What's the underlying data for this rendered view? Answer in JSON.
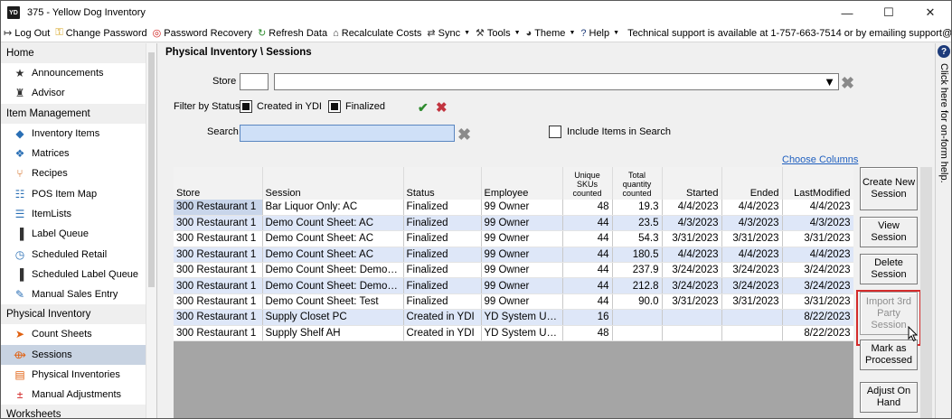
{
  "window": {
    "app_badge": "YD",
    "title": "375 - Yellow Dog Inventory",
    "controls": {
      "minimize": "—",
      "maximize": "☐",
      "close": "✕"
    }
  },
  "menubar": {
    "items": [
      {
        "label": "Log Out",
        "icon": "logout-icon",
        "glyph": "↦",
        "color": "#333333"
      },
      {
        "label": "Change Password",
        "icon": "key-icon",
        "glyph": "⚿",
        "color": "#d4a017"
      },
      {
        "label": "Password Recovery",
        "icon": "lifebuoy-icon",
        "glyph": "◎",
        "color": "#d0201e"
      },
      {
        "label": "Refresh Data",
        "icon": "refresh-icon",
        "glyph": "↻",
        "color": "#2e8b2e"
      },
      {
        "label": "Recalculate Costs",
        "icon": "bank-icon",
        "glyph": "⌂",
        "color": "#333333"
      },
      {
        "label": "Sync",
        "icon": "sync-icon",
        "glyph": "⇄",
        "color": "#333333",
        "dropdown": true
      },
      {
        "label": "Tools",
        "icon": "wrench-icon",
        "glyph": "⚒",
        "color": "#333333",
        "dropdown": true
      },
      {
        "label": "Theme",
        "icon": "palette-icon",
        "glyph": "◕",
        "color": "#333333",
        "dropdown": true
      },
      {
        "label": "Help",
        "icon": "help-icon",
        "glyph": "?",
        "color": "#1d3b7a",
        "dropdown": true
      }
    ],
    "support_text": "Technical support is available at 1-757-663-7514 or by emailing support@yellowdogsoftware.com."
  },
  "sidebar": {
    "sections": [
      {
        "header": "Home",
        "items": [
          {
            "label": "Announcements",
            "icon": "star-icon",
            "glyph": "★",
            "color": "#333333"
          },
          {
            "label": "Advisor",
            "icon": "advisor-icon",
            "glyph": "♜",
            "color": "#333333"
          }
        ]
      },
      {
        "header": "Item Management",
        "items": [
          {
            "label": "Inventory Items",
            "icon": "tag-icon",
            "glyph": "◆",
            "color": "#2a6fb5"
          },
          {
            "label": "Matrices",
            "icon": "cubes-icon",
            "glyph": "❖",
            "color": "#2a6fb5"
          },
          {
            "label": "Recipes",
            "icon": "utensils-icon",
            "glyph": "⑂",
            "color": "#d06010"
          },
          {
            "label": "POS Item Map",
            "icon": "sitemap-icon",
            "glyph": "☷",
            "color": "#2a6fb5"
          },
          {
            "label": "ItemLists",
            "icon": "list-icon",
            "glyph": "☰",
            "color": "#2a6fb5"
          },
          {
            "label": "Label Queue",
            "icon": "barcode-icon",
            "glyph": "▐",
            "color": "#333333"
          },
          {
            "label": "Scheduled Retail",
            "icon": "clock-icon",
            "glyph": "◷",
            "color": "#2a6fb5"
          },
          {
            "label": "Scheduled Label Queue",
            "icon": "barcode-icon",
            "glyph": "▐",
            "color": "#333333"
          },
          {
            "label": "Manual Sales Entry",
            "icon": "edit-icon",
            "glyph": "✎",
            "color": "#2a6fb5"
          }
        ]
      },
      {
        "header": "Physical Inventory",
        "items": [
          {
            "label": "Count Sheets",
            "icon": "send-icon",
            "glyph": "➤",
            "color": "#e06010"
          },
          {
            "label": "Sessions",
            "icon": "sessions-icon",
            "glyph": "⟴",
            "color": "#e06010",
            "selected": true
          },
          {
            "label": "Physical Inventories",
            "icon": "document-icon",
            "glyph": "▤",
            "color": "#e06010"
          },
          {
            "label": "Manual Adjustments",
            "icon": "plusminus-icon",
            "glyph": "±",
            "color": "#d02020"
          }
        ]
      },
      {
        "header": "Worksheets",
        "items": []
      }
    ]
  },
  "main": {
    "breadcrumb": "Physical Inventory \\ Sessions",
    "store_label": "Store",
    "store_code_value": "",
    "store_select_value": "",
    "filter_label": "Filter by Status",
    "filter_options": [
      {
        "label": "Created in YDI",
        "checked": true
      },
      {
        "label": "Finalized",
        "checked": true
      }
    ],
    "search_label": "Search",
    "search_value": "",
    "include_items_label": "Include Items in Search",
    "choose_columns": "Choose Columns"
  },
  "table": {
    "columns": [
      {
        "label": "Store",
        "align": "left"
      },
      {
        "label": "Session",
        "align": "left"
      },
      {
        "label": "Status",
        "align": "left"
      },
      {
        "label": "Employee",
        "align": "left"
      },
      {
        "label": "Unique SKUs counted",
        "align": "center"
      },
      {
        "label": "Total quantity counted",
        "align": "center"
      },
      {
        "label": "Started",
        "align": "right"
      },
      {
        "label": "Ended",
        "align": "right"
      },
      {
        "label": "LastModified",
        "align": "right"
      }
    ],
    "rows": [
      [
        "300 Restaurant 1",
        "Bar Liquor Only: AC",
        "Finalized",
        "99 Owner",
        "48",
        "19.3",
        "4/4/2023",
        "4/4/2023",
        "4/4/2023"
      ],
      [
        "300 Restaurant 1",
        "Demo Count Sheet: AC",
        "Finalized",
        "99 Owner",
        "44",
        "23.5",
        "4/3/2023",
        "4/3/2023",
        "4/3/2023"
      ],
      [
        "300 Restaurant 1",
        "Demo Count Sheet: AC",
        "Finalized",
        "99 Owner",
        "44",
        "54.3",
        "3/31/2023",
        "3/31/2023",
        "3/31/2023"
      ],
      [
        "300 Restaurant 1",
        "Demo Count Sheet: AC",
        "Finalized",
        "99 Owner",
        "44",
        "180.5",
        "4/4/2023",
        "4/4/2023",
        "4/4/2023"
      ],
      [
        "300 Restaurant 1",
        "Demo Count Sheet: Demo S...",
        "Finalized",
        "99 Owner",
        "44",
        "237.9",
        "3/24/2023",
        "3/24/2023",
        "3/24/2023"
      ],
      [
        "300 Restaurant 1",
        "Demo Count Sheet: Demo S...",
        "Finalized",
        "99 Owner",
        "44",
        "212.8",
        "3/24/2023",
        "3/24/2023",
        "3/24/2023"
      ],
      [
        "300 Restaurant 1",
        "Demo Count Sheet: Test",
        "Finalized",
        "99 Owner",
        "44",
        "90.0",
        "3/31/2023",
        "3/31/2023",
        "3/31/2023"
      ],
      [
        "300 Restaurant 1",
        "Supply Closet PC",
        "Created in YDI",
        "YD System User",
        "16",
        "",
        "",
        "",
        "8/22/2023"
      ],
      [
        "300 Restaurant 1",
        "Supply Shelf AH",
        "Created in YDI",
        "YD System User",
        "48",
        "",
        "",
        "",
        "8/22/2023"
      ]
    ]
  },
  "actions": [
    {
      "label": "Create New Session",
      "disabled": false
    },
    {
      "label": "View Session",
      "disabled": false
    },
    {
      "label": "Delete Session",
      "disabled": false
    },
    {
      "label": "Import 3rd Party Session",
      "disabled": true,
      "highlighted": true
    },
    {
      "label": "Mark as Processed",
      "disabled": false
    },
    {
      "label": "Adjust On Hand",
      "disabled": false
    }
  ],
  "help_strip": {
    "icon": "?",
    "text": "Click here for on-form help."
  },
  "colors": {
    "highlight_border": "#d42b2b",
    "row_alt": "#dee7f8",
    "sidebar_selected": "#c8d3e2",
    "link": "#1f5fbf"
  }
}
